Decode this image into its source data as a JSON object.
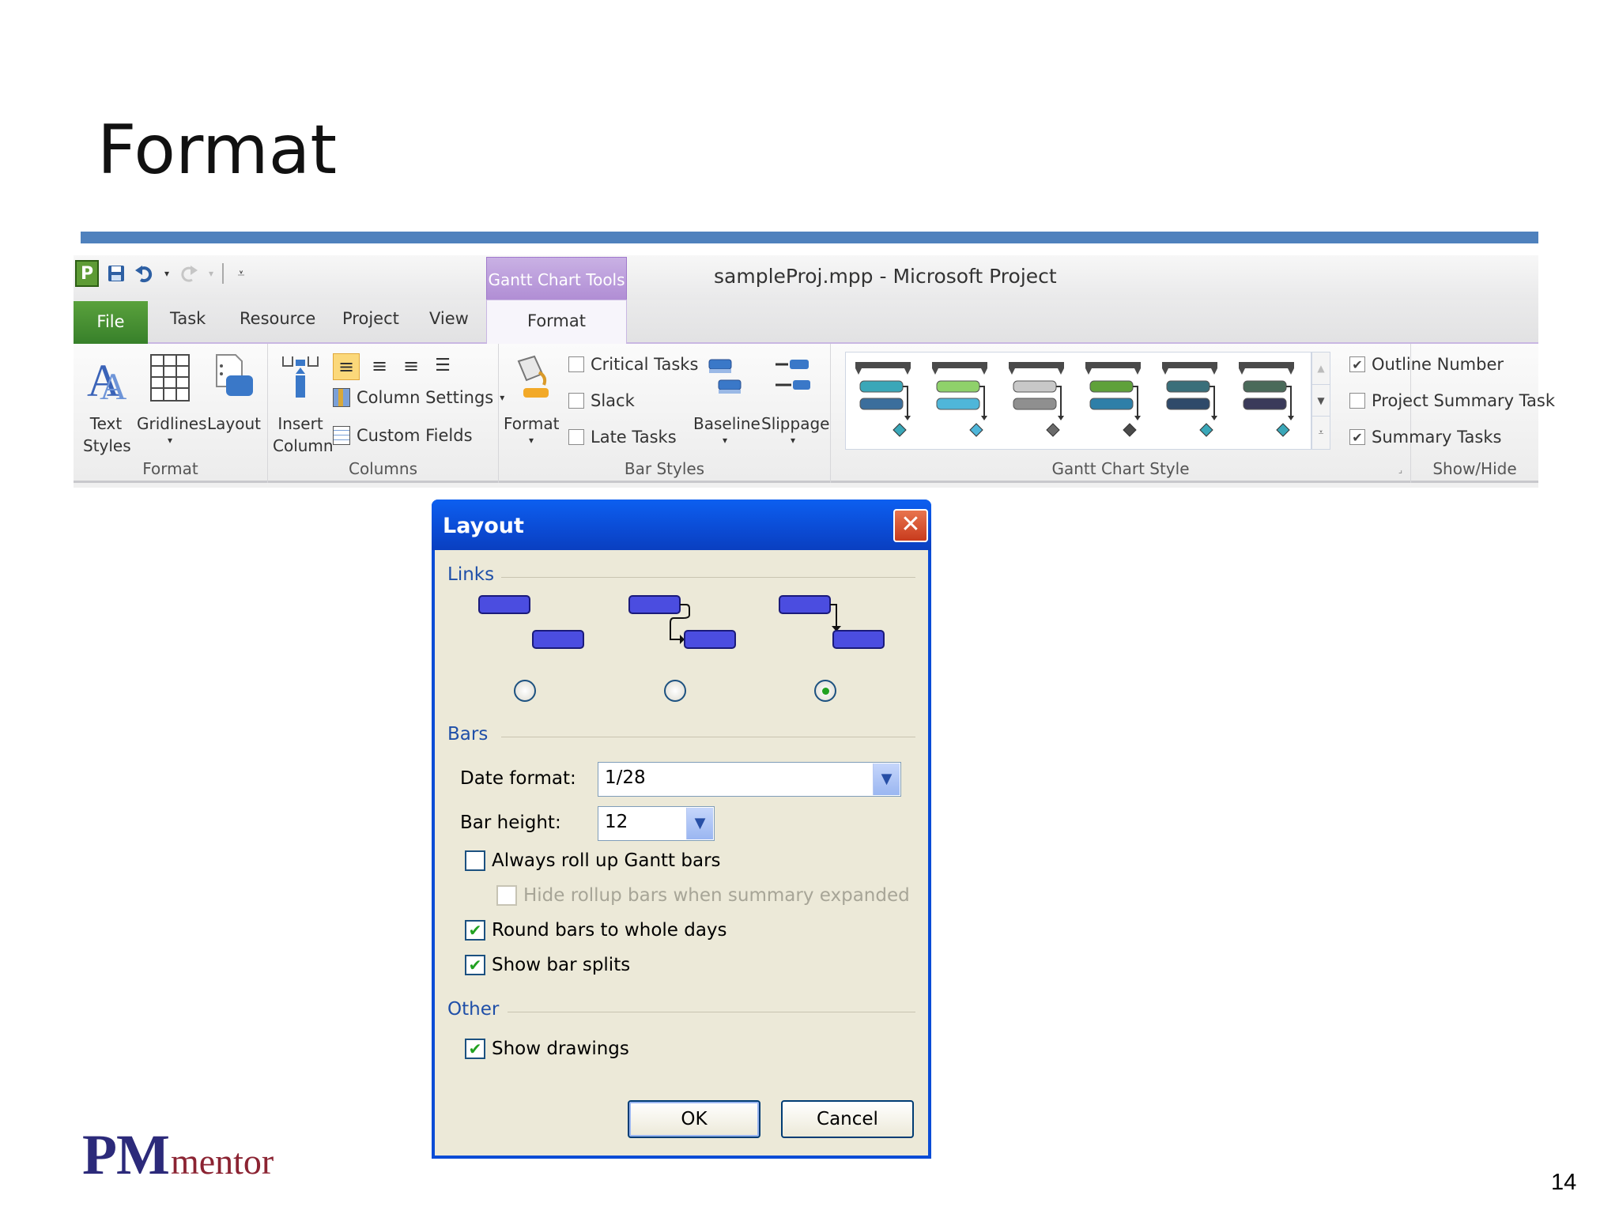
{
  "slide": {
    "title": "Format",
    "page_number": "14",
    "logo": {
      "pm": "PM",
      "mentor": "mentor"
    },
    "accent_color": "#4f81bd"
  },
  "ribbon": {
    "window_title": "sampleProj.mpp  -  Microsoft Project",
    "contextual_tab_group": "Gantt Chart Tools",
    "app_icon_letter": "P",
    "tabs": {
      "file": "File",
      "task": "Task",
      "resource": "Resource",
      "project": "Project",
      "view": "View",
      "format": "Format"
    },
    "groups": {
      "format": {
        "label": "Format",
        "text_styles_line1": "Text",
        "text_styles_line2": "Styles",
        "gridlines": "Gridlines",
        "layout": "Layout"
      },
      "columns": {
        "label": "Columns",
        "insert_line1": "Insert",
        "insert_line2": "Column",
        "column_settings": "Column Settings",
        "custom_fields": "Custom Fields"
      },
      "bar_styles": {
        "label": "Bar Styles",
        "format": "Format",
        "critical_tasks": "Critical Tasks",
        "slack": "Slack",
        "late_tasks": "Late Tasks",
        "baseline": "Baseline",
        "slippage": "Slippage"
      },
      "gantt_chart_style": {
        "label": "Gantt Chart Style",
        "styles": [
          {
            "summary": "#4a4a4a",
            "top": "#3aa7b8",
            "bottom": "#3b6e9c",
            "diamond": "#3aa7b8"
          },
          {
            "summary": "#4a4a4a",
            "top": "#8fd16a",
            "bottom": "#4fb6d9",
            "diamond": "#4fb6d9"
          },
          {
            "summary": "#4a4a4a",
            "top": "#c8c8c8",
            "bottom": "#8f8f8f",
            "diamond": "#6a6a6a"
          },
          {
            "summary": "#4a4a4a",
            "top": "#5fa13a",
            "bottom": "#2e7fa8",
            "diamond": "#4a4a4a"
          },
          {
            "summary": "#4a4a4a",
            "top": "#3a6f7a",
            "bottom": "#2f4a6a",
            "diamond": "#3aa7b8"
          },
          {
            "summary": "#4a4a4a",
            "top": "#4a6a5a",
            "bottom": "#3a3a5a",
            "diamond": "#3aa7b8"
          }
        ]
      },
      "show_hide": {
        "label": "Show/Hide",
        "outline_number": "Outline Number",
        "outline_number_checked": true,
        "project_summary_task": "Project Summary Task",
        "project_summary_task_checked": false,
        "summary_tasks": "Summary Tasks",
        "summary_tasks_checked": true
      }
    }
  },
  "dialog": {
    "title": "Layout",
    "links_section": "Links",
    "links_selected_index": 2,
    "bars_section": "Bars",
    "date_format_label": "Date format:",
    "date_format_value": "1/28",
    "bar_height_label": "Bar height:",
    "bar_height_value": "12",
    "always_roll_up": {
      "label": "Always roll up Gantt bars",
      "checked": false
    },
    "hide_rollup": {
      "label": "Hide rollup bars when summary expanded",
      "checked": false,
      "enabled": false
    },
    "round_bars": {
      "label": "Round bars to whole days",
      "checked": true
    },
    "show_bar_splits": {
      "label": "Show bar splits",
      "checked": true
    },
    "other_section": "Other",
    "show_drawings": {
      "label": "Show drawings",
      "checked": true
    },
    "ok_label": "OK",
    "cancel_label": "Cancel",
    "bar_color": "#4b4de0"
  }
}
